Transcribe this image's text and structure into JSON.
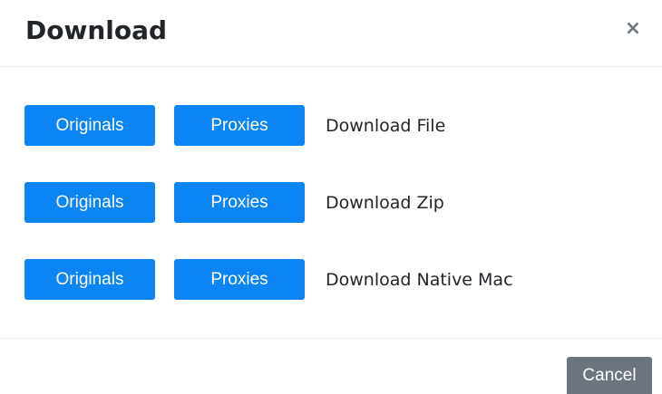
{
  "dialog": {
    "title": "Download",
    "close_symbol": "×",
    "close_icon": "close-icon"
  },
  "rows": [
    {
      "originals_label": "Originals",
      "proxies_label": "Proxies",
      "label": "Download File"
    },
    {
      "originals_label": "Originals",
      "proxies_label": "Proxies",
      "label": "Download Zip"
    },
    {
      "originals_label": "Originals",
      "proxies_label": "Proxies",
      "label": "Download Native Mac"
    }
  ],
  "footer": {
    "cancel_label": "Cancel"
  },
  "colors": {
    "primary": "#0b84f4",
    "secondary": "#6c757d",
    "text": "#212529",
    "divider": "#e9ecef"
  }
}
